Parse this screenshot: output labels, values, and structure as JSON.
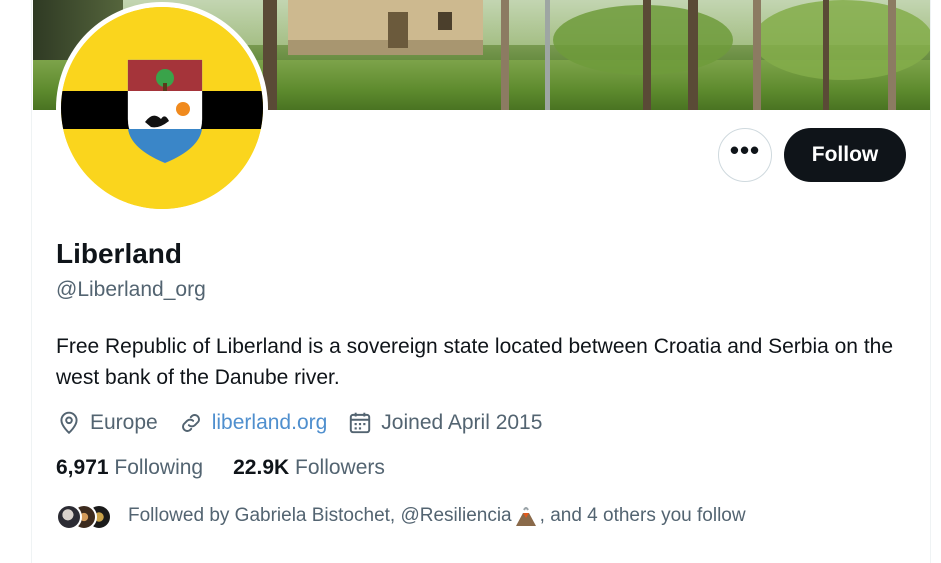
{
  "profile": {
    "name": "Liberland",
    "handle": "@Liberland_org",
    "bio": "Free Republic of Liberland is a sovereign state located between Croatia and Serbia on the west bank of the Danube river.",
    "location": "Europe",
    "website": "liberland.org",
    "joined": "Joined April 2015"
  },
  "actions": {
    "more_label": "•••",
    "follow_label": "Follow"
  },
  "stats": {
    "following_count": "6,971",
    "following_label": "Following",
    "followers_count": "22.9K",
    "followers_label": "Followers"
  },
  "followed_by": {
    "prefix": "Followed by Gabriela Bistochet, @Resiliencia",
    "suffix": ", and 4 others you follow"
  },
  "icons": {
    "location": "location-pin-icon",
    "website": "link-icon",
    "joined": "calendar-icon",
    "more": "more-dots-icon"
  },
  "colors": {
    "follow_bg": "#0f1419",
    "link": "#1d9bf0",
    "secondary_text": "#536471",
    "avatar_yellow": "#fad51d"
  }
}
